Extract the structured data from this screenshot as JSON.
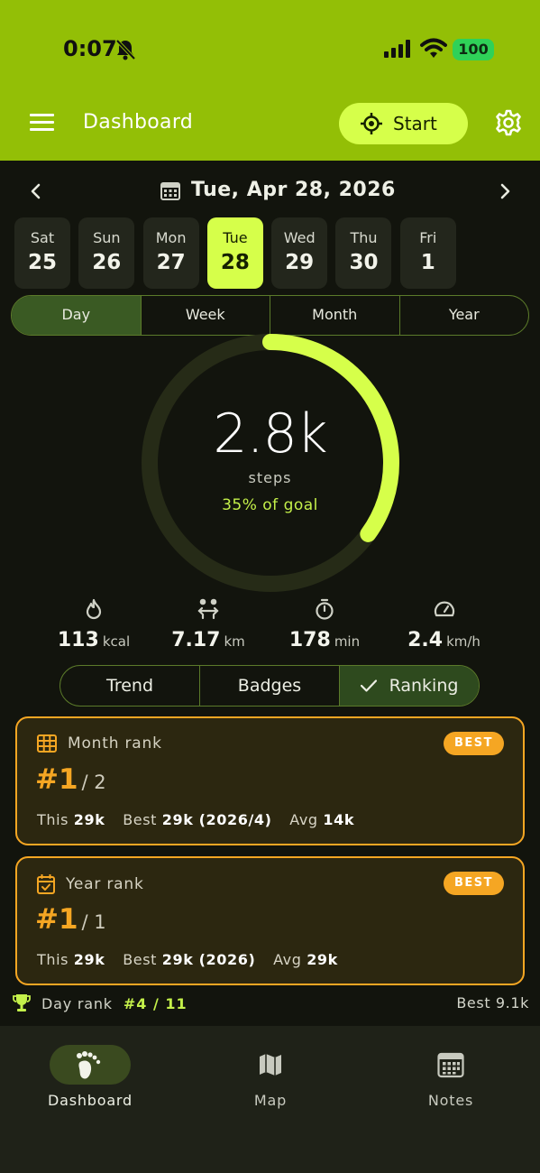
{
  "status": {
    "time": "0:07",
    "battery": "100"
  },
  "header": {
    "title": "Dashboard",
    "start_label": "Start"
  },
  "date_nav": {
    "title": "Tue, Apr 28, 2026"
  },
  "days": [
    {
      "name": "Sat",
      "num": "25",
      "selected": false
    },
    {
      "name": "Sun",
      "num": "26",
      "selected": false
    },
    {
      "name": "Mon",
      "num": "27",
      "selected": false
    },
    {
      "name": "Tue",
      "num": "28",
      "selected": true
    },
    {
      "name": "Wed",
      "num": "29",
      "selected": false
    },
    {
      "name": "Thu",
      "num": "30",
      "selected": false
    },
    {
      "name": "Fri",
      "num": "1",
      "selected": false
    }
  ],
  "periods": [
    {
      "label": "Day",
      "active": true
    },
    {
      "label": "Week",
      "active": false
    },
    {
      "label": "Month",
      "active": false
    },
    {
      "label": "Year",
      "active": false
    }
  ],
  "progress": {
    "value": "2.8k",
    "unit": "steps",
    "goal_text": "35% of goal",
    "fraction": 0.35
  },
  "stats": [
    {
      "icon": "flame-icon",
      "value": "113",
      "unit": "kcal"
    },
    {
      "icon": "distance-icon",
      "value": "7.17",
      "unit": "km"
    },
    {
      "icon": "stopwatch-icon",
      "value": "178",
      "unit": "min"
    },
    {
      "icon": "speedometer-icon",
      "value": "2.4",
      "unit": "km/h"
    }
  ],
  "tabs": [
    {
      "label": "Trend",
      "active": false
    },
    {
      "label": "Badges",
      "active": false
    },
    {
      "label": "Ranking",
      "active": true
    }
  ],
  "month_rank": {
    "title": "Month rank",
    "badge": "BEST",
    "rank": "#1",
    "total": "/ 2",
    "this_label": "This",
    "this_value": "29k",
    "best_label": "Best",
    "best_value": "29k (2026/4)",
    "avg_label": "Avg",
    "avg_value": "14k"
  },
  "year_rank": {
    "title": "Year rank",
    "badge": "BEST",
    "rank": "#1",
    "total": "/ 1",
    "this_label": "This",
    "this_value": "29k",
    "best_label": "Best",
    "best_value": "29k (2026)",
    "avg_label": "Avg",
    "avg_value": "29k"
  },
  "day_rank": {
    "label": "Day rank",
    "value": "#4 / 11",
    "best": "Best 9.1k"
  },
  "bottom_nav": [
    {
      "label": "Dashboard",
      "icon": "footprints-icon",
      "active": true
    },
    {
      "label": "Map",
      "icon": "map-icon",
      "active": false
    },
    {
      "label": "Notes",
      "icon": "calendar-icon",
      "active": false
    }
  ],
  "colors": {
    "accent": "#d6ff4a",
    "header": "#93bf06",
    "gold": "#f5a623",
    "background": "#12140d"
  }
}
